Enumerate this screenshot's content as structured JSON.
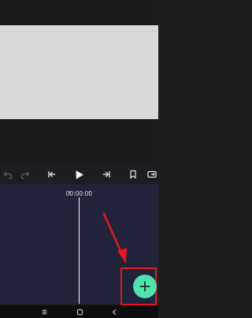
{
  "timeline": {
    "timecode": "00:00:00"
  },
  "colors": {
    "preview": "#d9d9d9",
    "timeline_bg": "#202339",
    "fab": "#4fe3ad",
    "annotation": "#e3191b"
  },
  "icons": {
    "toolbar": [
      "undo-icon",
      "redo-icon",
      "skip-to-start-icon",
      "play-icon",
      "skip-to-end-icon",
      "bookmark-icon",
      "export-icon"
    ],
    "fab": "plus-icon",
    "nav": [
      "recents-icon",
      "home-icon",
      "back-icon"
    ]
  }
}
